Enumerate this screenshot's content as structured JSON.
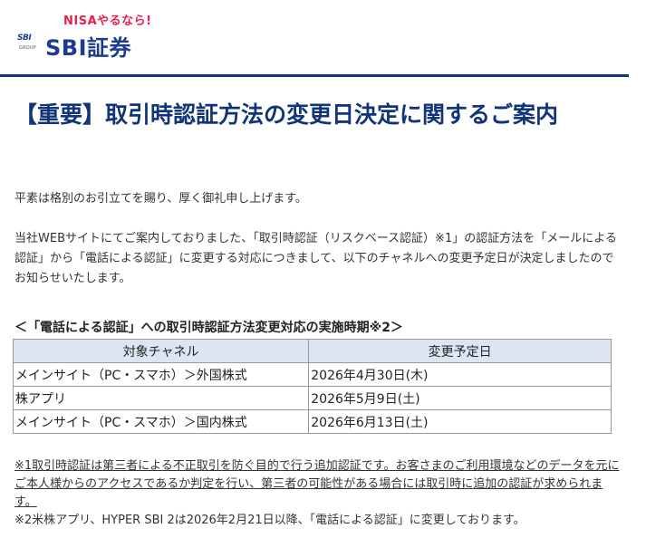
{
  "header": {
    "tagline": "NISAやるなら!",
    "mark_text": "SBI",
    "mark_group": "GROUP",
    "brand": "SBI証券"
  },
  "title": "【重要】取引時認証方法の変更日決定に関するご案内",
  "paragraphs": {
    "greeting": "平素は格別のお引立てを賜り、厚く御礼申し上げます。",
    "body": "当社WEBサイトにてご案内しておりました、「取引時認証（リスクベース認証）※1」の認証方法を「メールによる認証」から「電話による認証」に変更する対応につきまして、以下のチャネルへの変更予定日が決定しましたのでお知らせいたします。"
  },
  "section_title": "＜「電話による認証」への取引時認証方法変更対応の実施時期※2＞",
  "table": {
    "headers": [
      "対象チャネル",
      "変更予定日"
    ],
    "rows": [
      [
        "メインサイト（PC・スマホ）＞外国株式",
        "2026年4月30日(木)"
      ],
      [
        "株アプリ",
        "2026年5月9日(土)"
      ],
      [
        "メインサイト（PC・スマホ）＞国内株式",
        "2026年6月13日(土)"
      ]
    ]
  },
  "notes": {
    "note1": "※1取引時認証は第三者による不正取引を防ぐ目的で行う追加認証です。お客さまのご利用環境などのデータを元にご本人様からのアクセスであるか判定を行い、第三者の可能性がある場合には取引時に追加の認証が求められます。",
    "note2": "※2米株アプリ、HYPER SBI 2は2026年2月21日以降、「電話による認証」に変更しております。"
  },
  "colors": {
    "brand_blue": "#1d3c8f",
    "title_blue": "#12357a",
    "tagline_pink": "#e8204b",
    "table_header_bg": "#dce6f2"
  }
}
